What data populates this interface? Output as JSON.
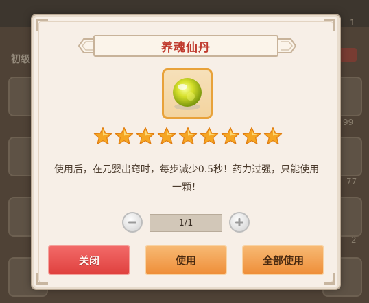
{
  "background": {
    "category_label": "初级",
    "slot_counts": [
      "1",
      "99",
      "77",
      "2"
    ]
  },
  "dialog": {
    "title": "养魂仙丹",
    "item_icon": "yellow-orb-icon",
    "star_count": 9,
    "description": "使用后，在元婴出窍时，每步减少0.5秒！药力过强，只能使用一颗！",
    "quantity": {
      "value": "1/1",
      "minus_icon": "minus-icon",
      "plus_icon": "plus-icon"
    },
    "buttons": {
      "close": "关闭",
      "use": "使用",
      "use_all": "全部使用"
    }
  },
  "colors": {
    "title_red": "#c03a2e",
    "close_red": "#e0423f",
    "use_orange": "#ef8f3a",
    "star_gold": "#f5a623"
  }
}
